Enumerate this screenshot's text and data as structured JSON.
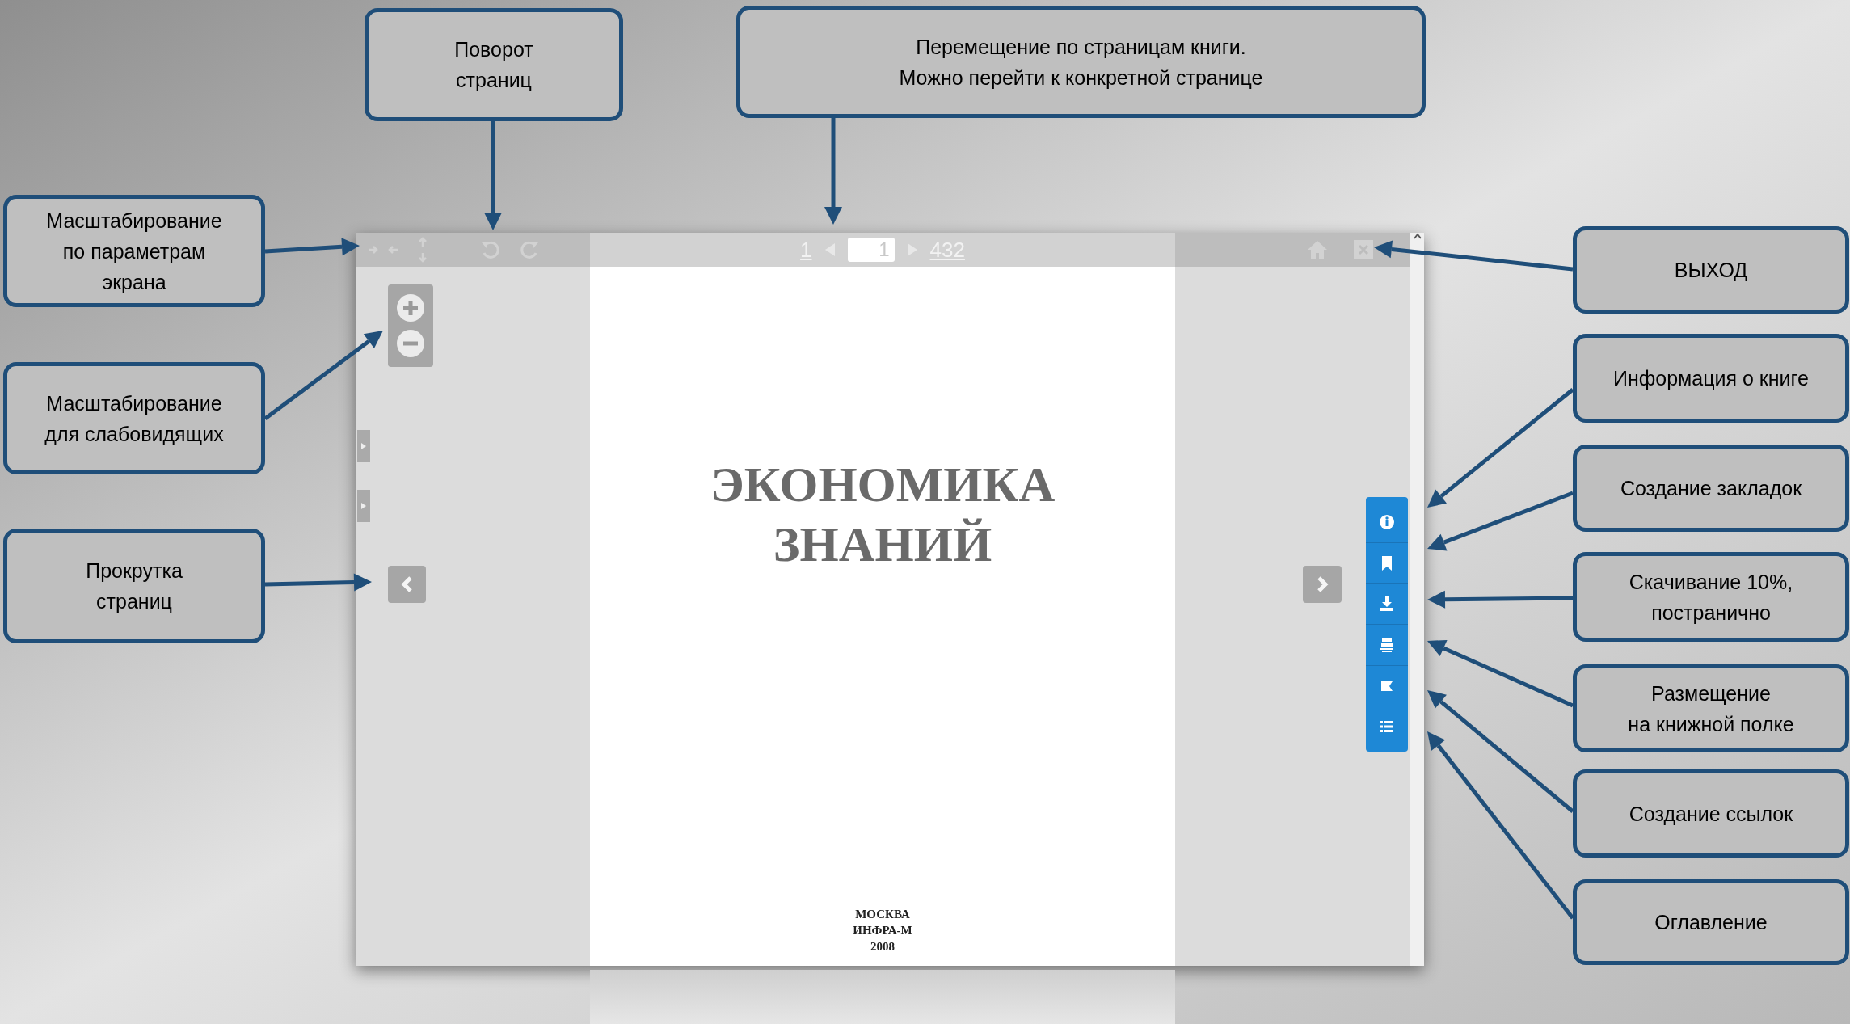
{
  "toolbar": {
    "first_page": "1",
    "page_input": "1",
    "last_page": "432"
  },
  "page": {
    "title_lines": [
      "ЭКОНОМИКА",
      "ЗНАНИЙ"
    ],
    "imprint_lines": [
      "МОСКВА",
      "ИНФРА-М",
      "2008"
    ]
  },
  "callouts": [
    {
      "text": "Поворот\nстраниц"
    },
    {
      "text": "Перемещение по страницам книги.\nМожно перейти к конкретной странице"
    },
    {
      "text": "Масштабирование\nпо параметрам\nэкрана"
    },
    {
      "text": "Масштабирование\nдля слабовидящих"
    },
    {
      "text": "Прокрутка\nстраниц"
    },
    {
      "text": "ВЫХОД"
    },
    {
      "text": "Информация о книге"
    },
    {
      "text": "Создание закладок"
    },
    {
      "text": "Скачивание 10%,\nпостранично"
    },
    {
      "text": "Размещение\nна книжной полке"
    },
    {
      "text": "Создание ссылок"
    },
    {
      "text": "Оглавление"
    }
  ]
}
